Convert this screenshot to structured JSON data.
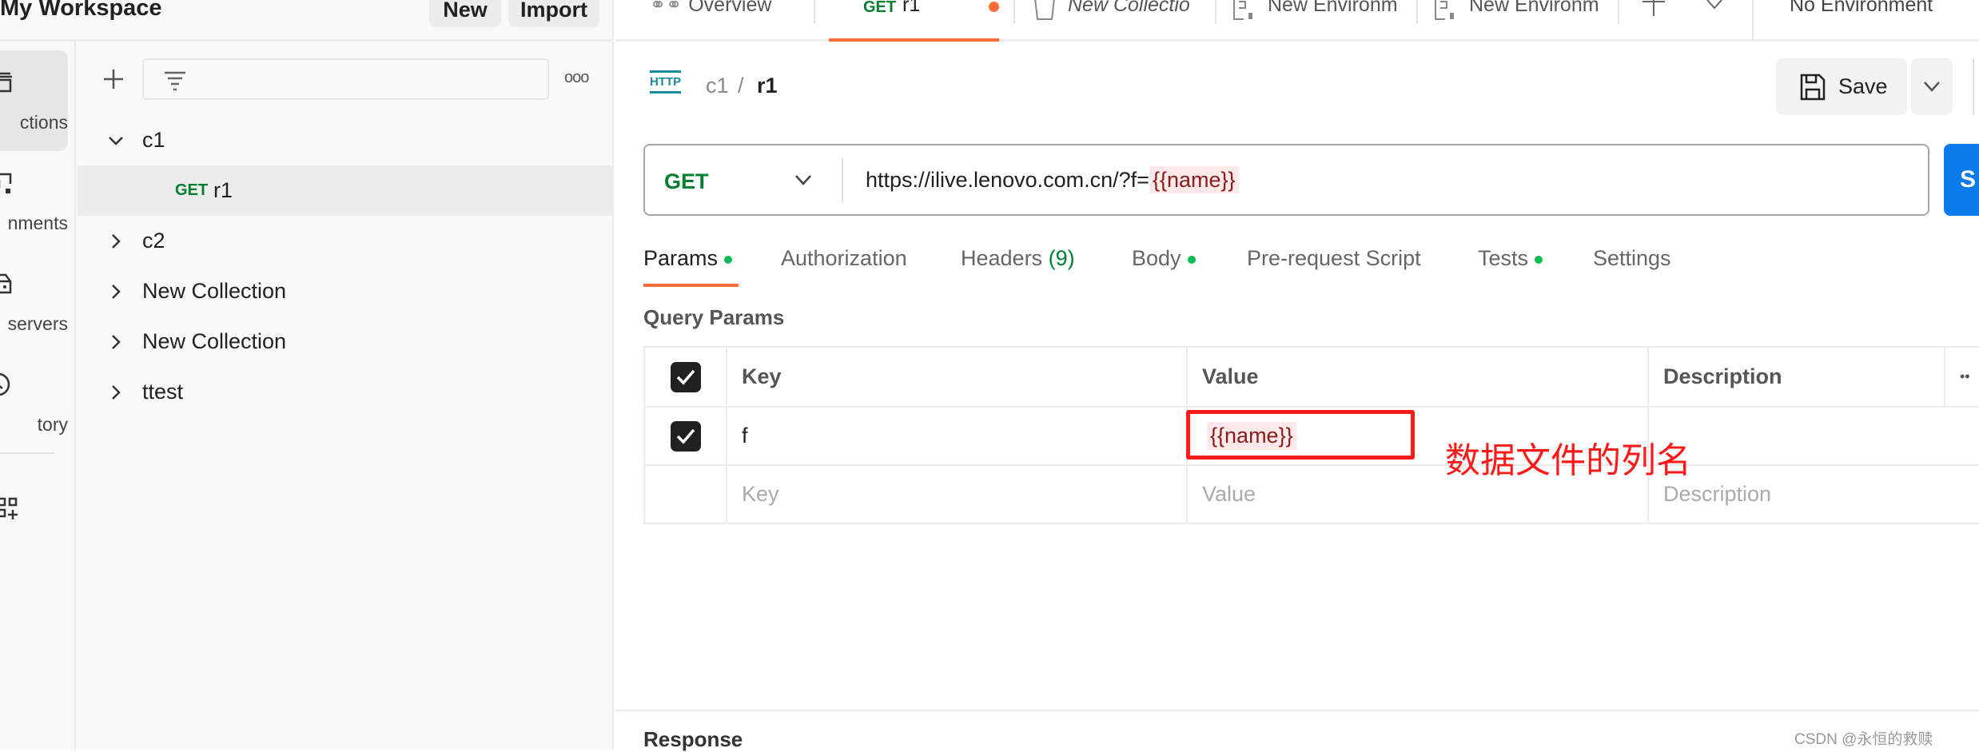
{
  "workspace": {
    "title": "My Workspace",
    "new_label": "New",
    "import_label": "Import"
  },
  "rail": {
    "items": [
      {
        "label": "ctions",
        "icon": "collections-icon",
        "active": true
      },
      {
        "label": "nments",
        "icon": "environments-icon"
      },
      {
        "label": "servers",
        "icon": "mock-servers-icon"
      },
      {
        "label": "tory",
        "icon": "history-icon"
      }
    ],
    "extra_icon": "configure-workspace-icon"
  },
  "sidebar": {
    "filter_placeholder": "",
    "tree": [
      {
        "label": "c1",
        "expanded": true
      },
      {
        "method": "GET",
        "label": "r1",
        "selected": true
      },
      {
        "label": "c2"
      },
      {
        "label": "New Collection"
      },
      {
        "label": "New Collection"
      },
      {
        "label": "ttest"
      }
    ]
  },
  "tabs": [
    {
      "label": "Overview",
      "icon": "overview-icon"
    },
    {
      "method": "GET",
      "label": "r1",
      "active": true,
      "unsaved": true
    },
    {
      "label": "New Collectio",
      "icon": "collection-icon",
      "italic": true
    },
    {
      "label": "New Environm",
      "icon": "environment-icon"
    },
    {
      "label": "New Environm",
      "icon": "environment-icon"
    }
  ],
  "environment": {
    "selected": "No Environment"
  },
  "request": {
    "breadcrumb": {
      "icon_text": "HTTP",
      "parent": "c1",
      "sep": "/",
      "name": "r1"
    },
    "save_label": "Save",
    "method": "GET",
    "url_prefix": "https://ilive.lenovo.com.cn/?f=",
    "url_var": "{{name}}",
    "send_label": "S",
    "tabs": [
      {
        "label": "Params",
        "dot": true,
        "active": true
      },
      {
        "label": "Authorization"
      },
      {
        "label": "Headers",
        "count": "(9)"
      },
      {
        "label": "Body",
        "dot": true
      },
      {
        "label": "Pre-request Script"
      },
      {
        "label": "Tests",
        "dot": true
      },
      {
        "label": "Settings"
      }
    ],
    "query_params_title": "Query Params",
    "table": {
      "headers": {
        "key": "Key",
        "value": "Value",
        "description": "Description"
      },
      "rows": [
        {
          "checked": true,
          "key": "f",
          "value": "{{name}}",
          "description": ""
        }
      ],
      "placeholders": {
        "key": "Key",
        "value": "Value",
        "description": "Description"
      }
    }
  },
  "annotation": {
    "text": "数据文件的列名",
    "color": "#ff1a1a"
  },
  "response": {
    "title": "Response"
  },
  "watermark": "CSDN @永恒的救赎",
  "colors": {
    "accent": "#ff6c37",
    "get": "#007f31",
    "send": "#097bed",
    "dot": "#0cbb52"
  }
}
